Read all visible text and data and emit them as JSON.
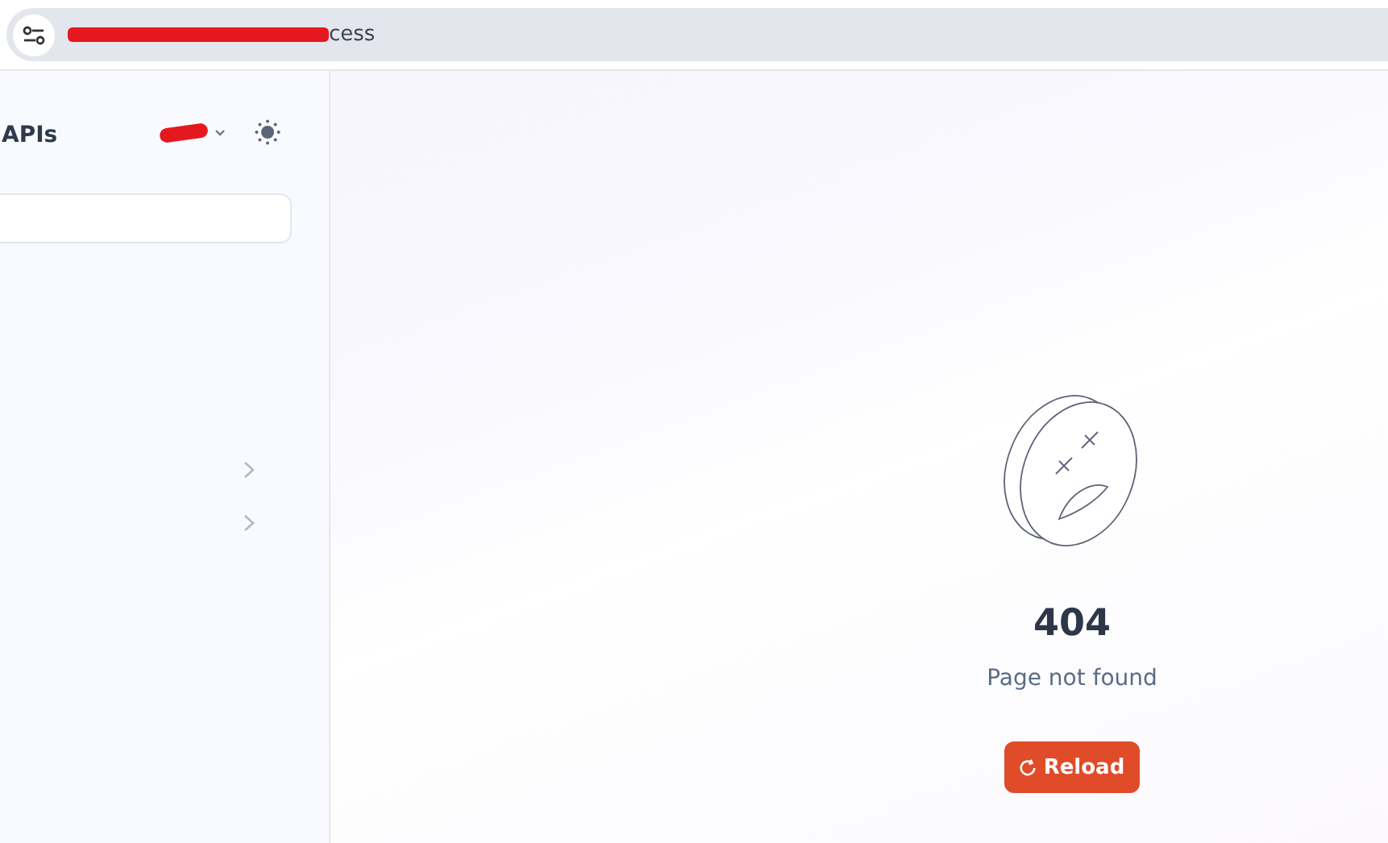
{
  "address_bar": {
    "url": "cess"
  },
  "sidebar": {
    "title": "APIs",
    "nav_items": [
      {
        "expanded": false
      },
      {
        "expanded": false
      }
    ]
  },
  "error": {
    "code": "404",
    "message": "Page not found",
    "button": "Reload"
  }
}
